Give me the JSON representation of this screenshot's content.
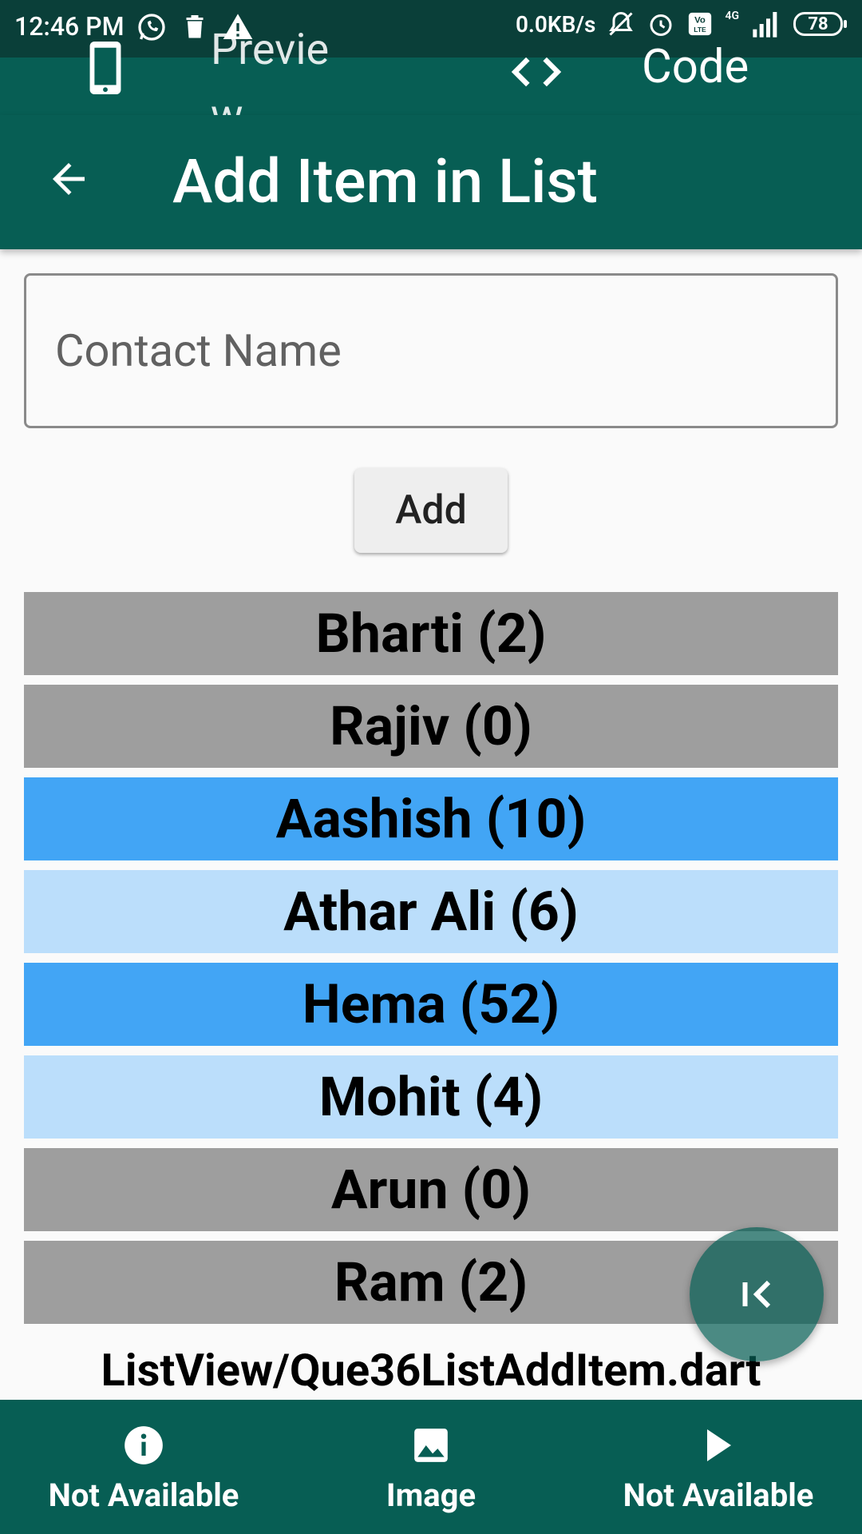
{
  "status_bar": {
    "time": "12:46 PM",
    "network_speed": "0.0KB/s",
    "network_type": "4G",
    "battery": "78",
    "icons": [
      "whatsapp-icon",
      "delete-icon",
      "warning-icon",
      "mute-icon",
      "alarm-icon",
      "volte-icon",
      "signal-icon",
      "battery-icon"
    ]
  },
  "tab_bar": {
    "preview_label": "Preview",
    "code_label": "Code"
  },
  "app_bar": {
    "title": "Add Item in List"
  },
  "input": {
    "placeholder": "Contact Name",
    "value": ""
  },
  "add_button": {
    "label": "Add"
  },
  "list": [
    {
      "label": "Bharti (2)",
      "color": "#9e9e9e"
    },
    {
      "label": "Rajiv (0)",
      "color": "#9e9e9e"
    },
    {
      "label": "Aashish (10)",
      "color": "#42a5f5"
    },
    {
      "label": "Athar Ali (6)",
      "color": "#bbdefb"
    },
    {
      "label": "Hema (52)",
      "color": "#42a5f5"
    },
    {
      "label": "Mohit (4)",
      "color": "#bbdefb"
    },
    {
      "label": "Arun (0)",
      "color": "#9e9e9e"
    },
    {
      "label": "Ram (2)",
      "color": "#9e9e9e"
    }
  ],
  "file_path": "ListView/Que36ListAddItem.dart",
  "bottom_nav": [
    {
      "label": "Not Available",
      "icon": "info-icon"
    },
    {
      "label": "Image",
      "icon": "image-icon"
    },
    {
      "label": "Not Available",
      "icon": "play-icon"
    }
  ],
  "colors": {
    "primary": "#075e54",
    "status_bar": "#0a3f39",
    "row_grey": "#9e9e9e",
    "row_blue": "#42a5f5",
    "row_light_blue": "#bbdefb"
  }
}
